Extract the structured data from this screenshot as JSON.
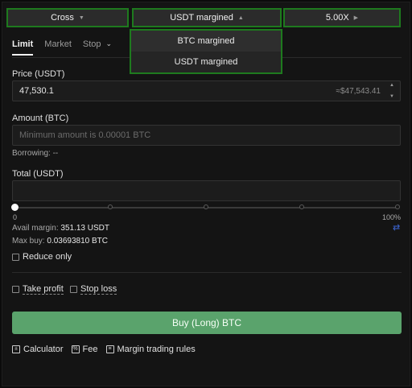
{
  "mode_bar": {
    "cross_label": "Cross",
    "margin_label": "USDT margined",
    "leverage_label": "5.00X",
    "caret_down": "▼",
    "caret_up": "▲",
    "caret_right": "▶"
  },
  "dropdown": {
    "options": [
      "BTC margined",
      "USDT margined"
    ],
    "highlighted_index": 0
  },
  "tabs": [
    {
      "label": "Limit",
      "active": true
    },
    {
      "label": "Market",
      "active": false
    },
    {
      "label": "Stop",
      "active": false
    }
  ],
  "price": {
    "label": "Price (USDT)",
    "value": "47,530.1",
    "approx": "≈$47,543.41"
  },
  "amount": {
    "label": "Amount (BTC)",
    "placeholder": "Minimum amount is 0.00001 BTC",
    "borrowing_label": "Borrowing:",
    "borrowing_value": "--"
  },
  "total": {
    "label": "Total (USDT)",
    "value": ""
  },
  "slider": {
    "min_label": "0",
    "max_label": "100%",
    "position_fraction": 0
  },
  "margin_info": {
    "avail_label": "Avail margin:",
    "avail_value": "351.13 USDT",
    "maxbuy_label": "Max buy:",
    "maxbuy_value": "0.03693810 BTC"
  },
  "options": {
    "reduce_only": "Reduce only",
    "take_profit": "Take profit",
    "stop_loss": "Stop loss"
  },
  "buy_button_label": "Buy (Long) BTC",
  "tools": {
    "calculator": "Calculator",
    "fee": "Fee",
    "margin_rules": "Margin trading rules"
  },
  "colors": {
    "accent_green": "#5aa36c",
    "highlight_border": "#1e7a1e",
    "swap_blue": "#3d66d6"
  }
}
